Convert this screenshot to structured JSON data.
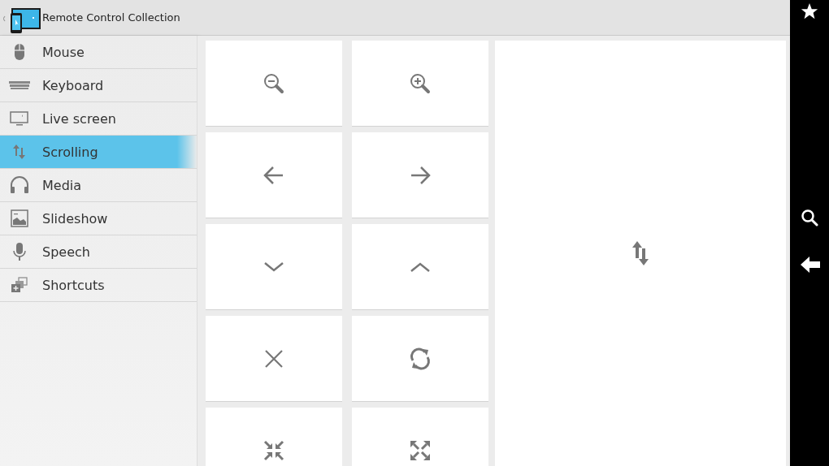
{
  "app_bar": {
    "title": "Remote Control Collection"
  },
  "nav": [
    {
      "label": "Mouse",
      "kind": "mouse",
      "selected": false
    },
    {
      "label": "Keyboard",
      "kind": "keyboard",
      "selected": false
    },
    {
      "label": "Live screen",
      "kind": "monitor",
      "selected": false
    },
    {
      "label": "Scrolling",
      "kind": "updown",
      "selected": true
    },
    {
      "label": "Media",
      "kind": "headphones",
      "selected": false
    },
    {
      "label": "Slideshow",
      "kind": "image",
      "selected": false
    },
    {
      "label": "Speech",
      "kind": "mic",
      "selected": false
    },
    {
      "label": "Shortcuts",
      "kind": "shortcuts",
      "selected": false
    }
  ],
  "pad_buttons": [
    {
      "kind": "zoom-out"
    },
    {
      "kind": "zoom-in"
    },
    {
      "kind": "left"
    },
    {
      "kind": "right"
    },
    {
      "kind": "down"
    },
    {
      "kind": "up"
    },
    {
      "kind": "close"
    },
    {
      "kind": "refresh"
    },
    {
      "kind": "collapse"
    },
    {
      "kind": "expand"
    }
  ],
  "scroll_pad": {
    "kind": "updown"
  },
  "system_bar": [
    {
      "kind": "star"
    },
    {
      "kind": "search"
    },
    {
      "kind": "back"
    }
  ]
}
